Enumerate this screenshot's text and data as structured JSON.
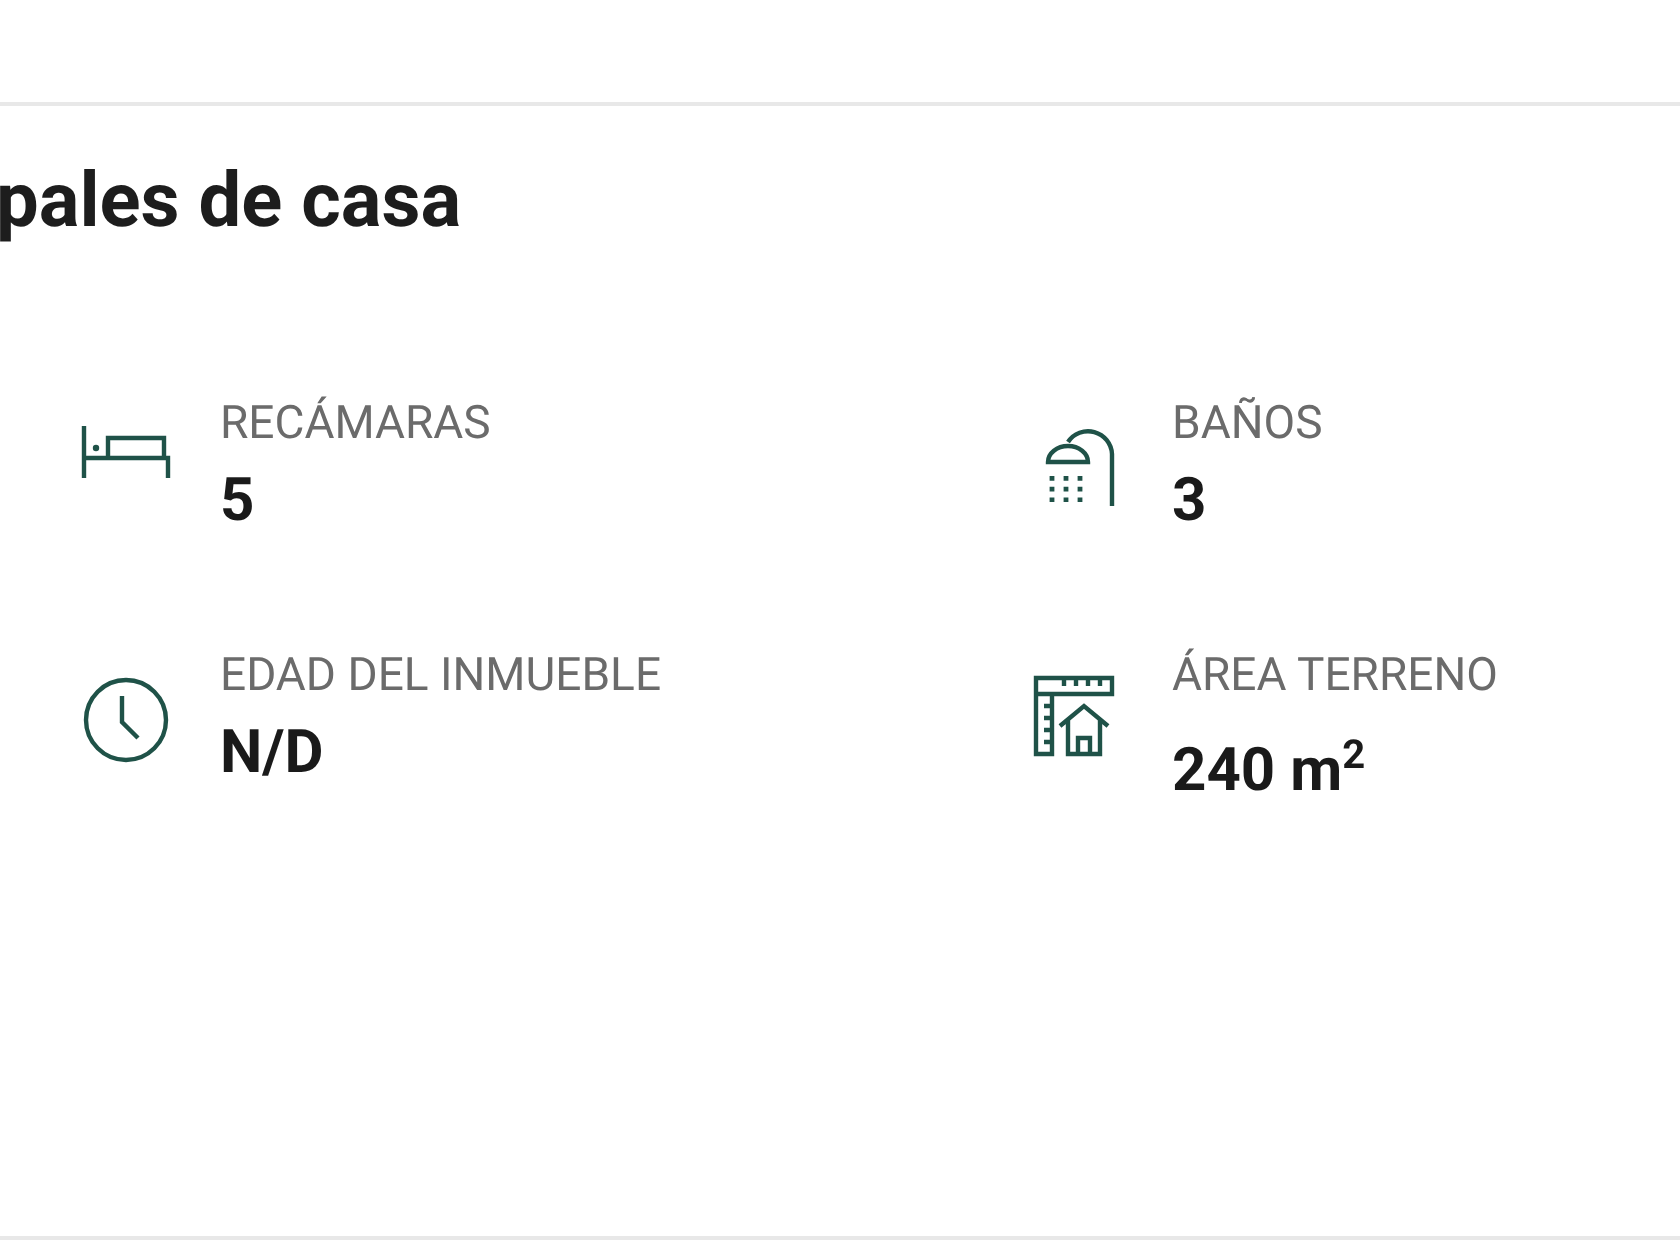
{
  "section": {
    "title": "pales de casa",
    "features": [
      {
        "kind": "bed",
        "label": "RECÁMARAS",
        "value": "5"
      },
      {
        "kind": "shower",
        "label": "BAÑOS",
        "value": "3"
      },
      {
        "kind": "clock",
        "label": "EDAD DEL INMUEBLE",
        "value": "N/D"
      },
      {
        "kind": "plot",
        "label": "ÁREA TERRENO",
        "value": "240 m$^{2}$"
      }
    ]
  }
}
